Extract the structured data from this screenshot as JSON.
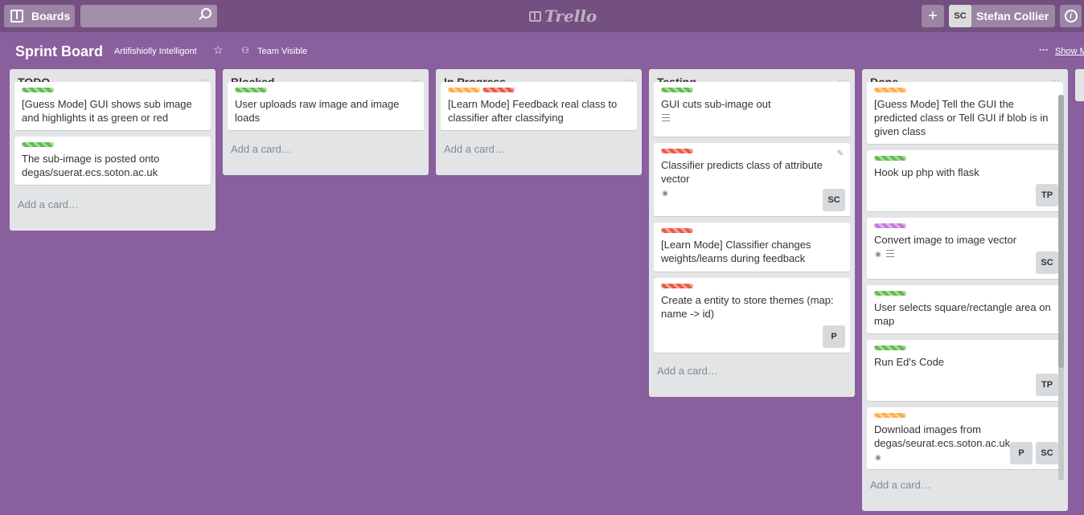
{
  "header": {
    "boards_label": "Boards",
    "logo_text": "Trello",
    "plus_label": "+",
    "user_initials": "SC",
    "user_name": "Stefan Collier",
    "info_label": "i"
  },
  "board": {
    "title": "Sprint Board",
    "team": "Artifishiolly Intelligont",
    "visibility": "Team Visible",
    "more": "···",
    "show_menu": "Show Menu"
  },
  "colors": {
    "green": "#61bd4f",
    "orange": "#ffab4a",
    "red": "#eb5a46",
    "purple": "#c377e0"
  },
  "lists": [
    {
      "title": "TODO",
      "menu": "···",
      "add": "Add a card…",
      "cards": [
        {
          "text": "[Guess Mode] GUI shows sub image and highlights it as green or red",
          "labels": [
            "green"
          ]
        },
        {
          "text": "The sub-image is posted onto degas/suerat.ecs.soton.ac.uk",
          "labels": [
            "green"
          ]
        }
      ]
    },
    {
      "title": "Blocked",
      "menu": "···",
      "add": "Add a card…",
      "cards": [
        {
          "text": "User uploads raw image and image loads",
          "labels": [
            "green"
          ]
        }
      ]
    },
    {
      "title": "In Progress",
      "menu": "···",
      "add": "Add a card…",
      "cards": [
        {
          "text": "[Learn Mode] Feedback real class to classifier after classifying",
          "labels": [
            "orange",
            "red"
          ]
        }
      ]
    },
    {
      "title": "Testing",
      "menu": "···",
      "add": "Add a card…",
      "cards": [
        {
          "text": "GUI cuts sub-image out",
          "labels": [
            "green"
          ],
          "desc": true
        },
        {
          "text": "Classifier predicts class of attribute vector",
          "labels": [
            "red"
          ],
          "watch": true,
          "members": [
            "SC"
          ]
        },
        {
          "text": "[Learn Mode] Classifier changes weights/learns during feedback",
          "labels": [
            "red"
          ]
        },
        {
          "text": "Create a entity to store themes (map: name -> id)",
          "labels": [
            "red"
          ],
          "members": [
            "P"
          ]
        }
      ]
    },
    {
      "title": "Done",
      "menu": "···",
      "add": "Add a card…",
      "cards": [
        {
          "text": "[Guess Mode] Tell the GUI the predicted class or Tell GUI if blob is in given class",
          "labels": [
            "orange"
          ]
        },
        {
          "text": "Hook up php with flask",
          "labels": [
            "green"
          ],
          "members": [
            "TP"
          ]
        },
        {
          "text": "Convert image to image vector",
          "labels": [
            "purple"
          ],
          "watch": true,
          "desc": true,
          "members": [
            "SC"
          ]
        },
        {
          "text": "User selects square/rectangle area on map",
          "labels": [
            "green"
          ]
        },
        {
          "text": "Run Ed's Code",
          "labels": [
            "green"
          ],
          "members": [
            "TP"
          ]
        },
        {
          "text": "Download images from degas/seurat.ecs.soton.ac.uk",
          "labels": [
            "orange"
          ],
          "watch": true,
          "members": [
            "P",
            "SC"
          ]
        }
      ]
    }
  ]
}
